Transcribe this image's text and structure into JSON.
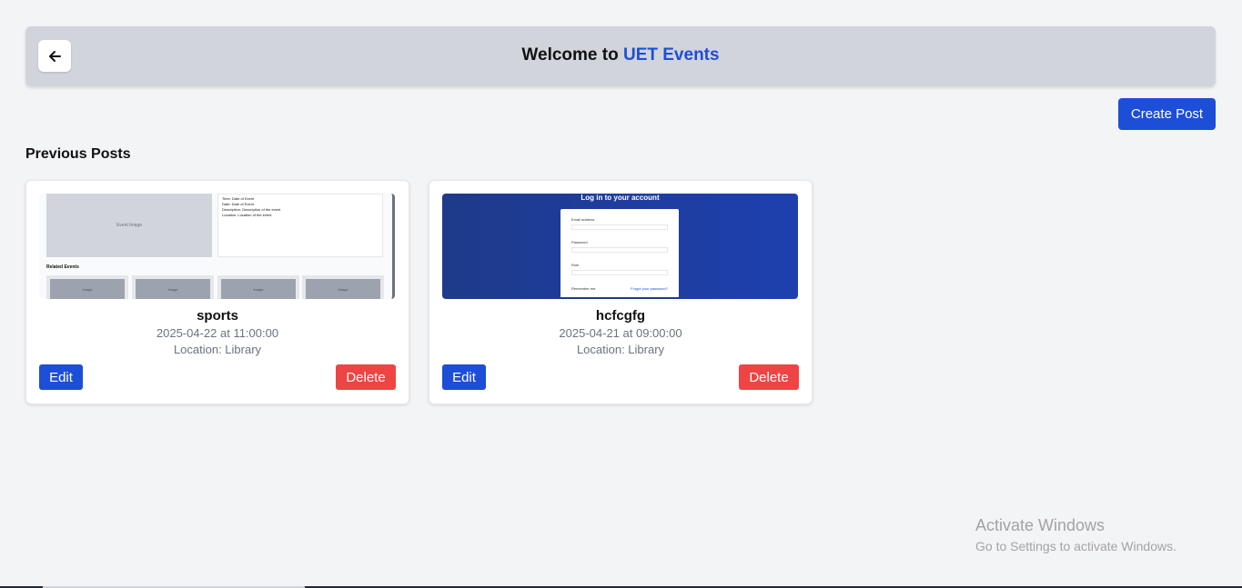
{
  "header": {
    "back_icon": "arrow-left-icon",
    "title_prefix": "Welcome to",
    "title_brand": "UET Events",
    "brand_color": "#1d4ed8"
  },
  "toolbar": {
    "create_label": "Create Post"
  },
  "section": {
    "title": "Previous Posts"
  },
  "posts": [
    {
      "name": "sports",
      "datetime": "2025-04-22 at 11:00:00",
      "location": "Location: Library",
      "edit_label": "Edit",
      "delete_label": "Delete",
      "thumb": {
        "image_label": "Event Image",
        "info_lines": [
          "Time: Date of Event",
          "Date: Date of Event",
          "Description: Description of the event",
          "Location: Location of the event"
        ],
        "related_label": "Related Events",
        "related_items": [
          "Image",
          "Image",
          "Image",
          "Image"
        ]
      }
    },
    {
      "name": "hcfcgfg",
      "datetime": "2025-04-21 at 09:00:00",
      "location": "Location: Library",
      "edit_label": "Edit",
      "delete_label": "Delete",
      "thumb": {
        "title": "Log in to your account",
        "email_label": "Email address",
        "password_label": "Password",
        "role_label": "Role",
        "remember_label": "Remember me",
        "forgot_label": "Forgot your password?"
      }
    }
  ],
  "watermark": {
    "title": "Activate Windows",
    "subtitle": "Go to Settings to activate Windows."
  },
  "colors": {
    "primary": "#1d4ed8",
    "danger": "#ef4444",
    "header_bg": "#d1d5db",
    "page_bg": "#f3f4f6"
  }
}
